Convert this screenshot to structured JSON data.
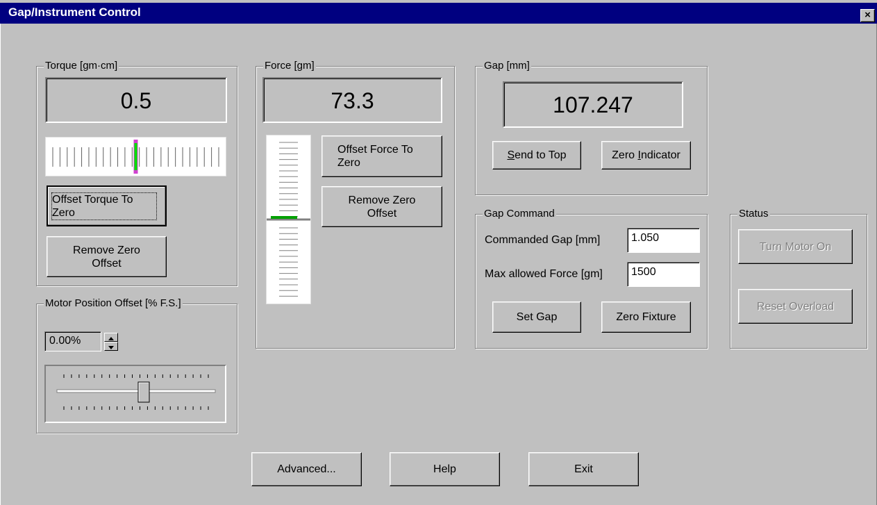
{
  "window": {
    "title": "Gap/Instrument Control",
    "close_label": "×"
  },
  "torque": {
    "label": "Torque [gm·cm]",
    "value": "0.5",
    "indicator_level": 0.5,
    "offset_button": "Offset Torque To Zero",
    "remove_offset_button": "Remove Zero Offset"
  },
  "force": {
    "label": "Force [gm]",
    "value": "73.3",
    "offset_button": "Offset Force To Zero",
    "remove_offset_button": "Remove Zero Offset"
  },
  "gap": {
    "label": "Gap [mm]",
    "value": "107.247",
    "send_to_top_pre": "",
    "send_to_top_u": "S",
    "send_to_top_post": "end to Top",
    "zero_indicator_pre": "Zero ",
    "zero_indicator_u": "I",
    "zero_indicator_post": "ndicator"
  },
  "gap_command": {
    "label": "Gap Command",
    "commanded_gap_label": "Commanded Gap [mm]",
    "commanded_gap_value": "1.050",
    "max_force_label": "Max allowed Force [gm]",
    "max_force_value": "1500",
    "set_gap_button": "Set Gap",
    "zero_fixture_button": "Zero Fixture"
  },
  "status": {
    "label": "Status",
    "motor_button": "Turn Motor On",
    "reset_button": "Reset Overload"
  },
  "motor_offset": {
    "label": "Motor Position Offset [% F.S.]",
    "spin_value": "0.00%",
    "slider_level": 0.5
  },
  "footer": {
    "advanced_button": "Advanced...",
    "help_button": "Help",
    "exit_button": "Exit"
  },
  "colors": {
    "titlebar": "#000080",
    "window": "#c0c0c0",
    "indicator_green": "#00e000",
    "torque_marker": "#d040d0"
  }
}
